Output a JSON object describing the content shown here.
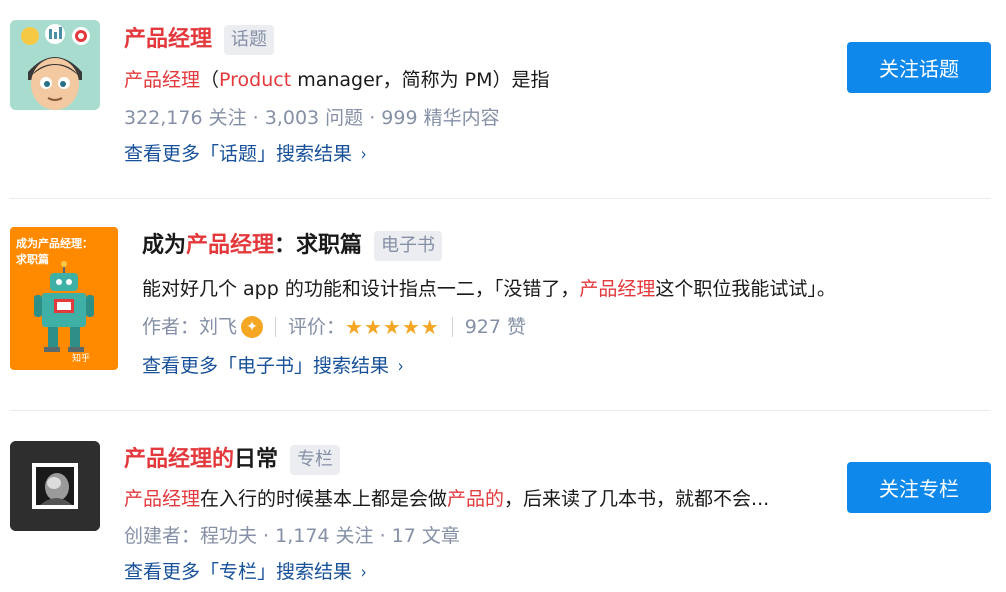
{
  "topic": {
    "title": "产品经理",
    "tag": "话题",
    "excerpt_hl1": "产品经理",
    "excerpt_p1": "（",
    "excerpt_hl2": "Product",
    "excerpt_p2": " manager，简称为 PM）是指",
    "meta": "322,176 关注 · 3,003 问题 · 999 精华内容",
    "more": "查看更多「话题」搜索结果",
    "button": "关注话题",
    "chevron": "›"
  },
  "ebook": {
    "title_a": "成为",
    "title_hl": "产品经理",
    "title_b": "：求职篇",
    "tag": "电子书",
    "cover_title": "成为产品经理：",
    "cover_subtitle": "求职篇",
    "cover_brand": "知乎",
    "excerpt_p1": "能对好几个 app 的功能和设计指点一二，「没错了，",
    "excerpt_hl": "产品经理",
    "excerpt_p2": "这个职位我能试试」。",
    "author_label": "作者：刘飞",
    "rating_label": "评价：",
    "stars": "★★★★★",
    "likes": "927 赞",
    "more": "查看更多「电子书」搜索结果",
    "chevron": "›",
    "verify_glyph": "✦"
  },
  "column": {
    "title_hl": "产品经理的",
    "title_b": "日常",
    "tag": "专栏",
    "excerpt_hl1": "产品经理",
    "excerpt_p1": "在入行的时候基本上都是会做",
    "excerpt_hl2": "产品的",
    "excerpt_p2": "，后来读了几本书，就都不会...",
    "meta": "创建者：程功夫 · 1,174 关注 · 17 文章",
    "more": "查看更多「专栏」搜索结果",
    "button": "关注专栏",
    "chevron": "›"
  },
  "colors": {
    "highlight": "#e4393c",
    "link": "#175199",
    "meta": "#8590a6",
    "button": "#0f88eb",
    "star": "#f5a623"
  }
}
